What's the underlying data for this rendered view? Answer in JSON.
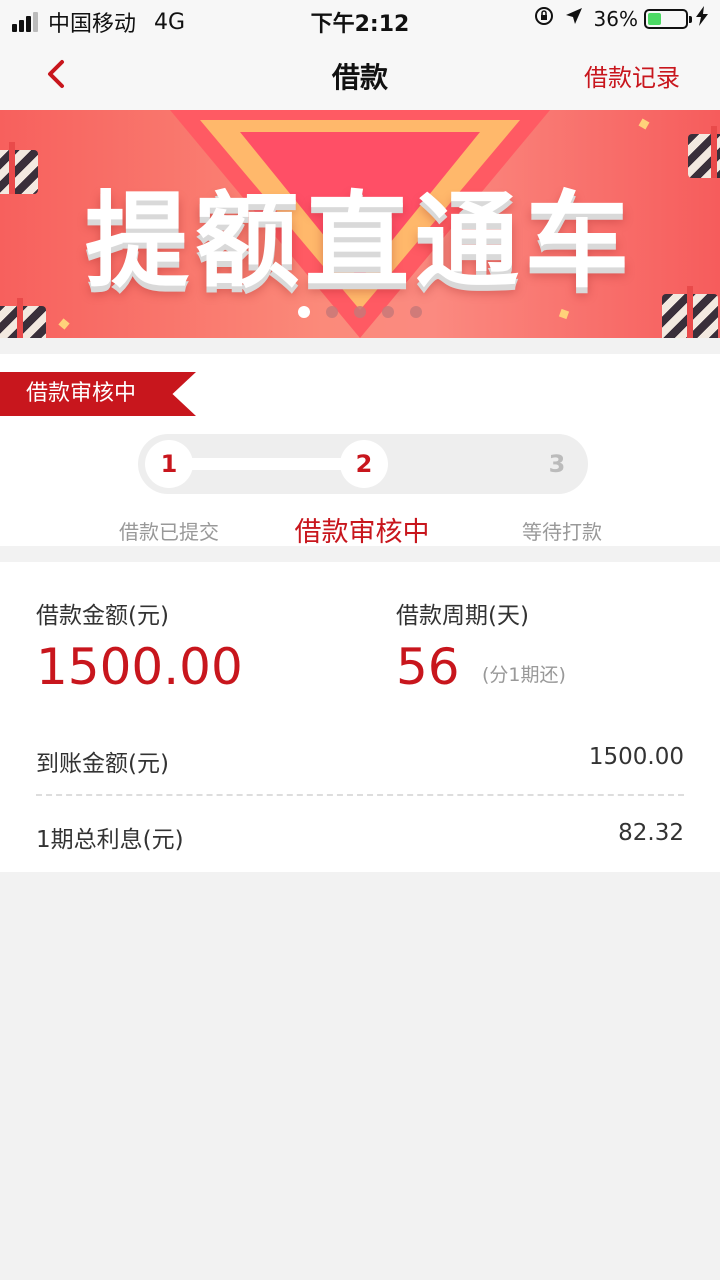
{
  "status_bar": {
    "carrier": "中国移动",
    "network": "4G",
    "time": "下午2:12",
    "battery": "36%",
    "battery_level": 0.36
  },
  "nav": {
    "title": "借款",
    "right_link": "借款记录"
  },
  "banner": {
    "headline": "提额直通车",
    "slide_count": 5,
    "active_slide": 1
  },
  "progress": {
    "ribbon": "借款审核中",
    "steps": [
      {
        "number": "1",
        "label": "借款已提交"
      },
      {
        "number": "2",
        "label": "借款审核中"
      },
      {
        "number": "3",
        "label": "等待打款"
      }
    ],
    "current_step": 2
  },
  "loan": {
    "amount_label": "借款金额(元)",
    "amount": "1500.00",
    "period_label": "借款周期(天)",
    "period": "56",
    "period_note": "(分1期还)",
    "received_label": "到账金额(元)",
    "received": "1500.00",
    "interest_label": "1期总利息(元)",
    "interest": "82.32"
  },
  "colors": {
    "accent": "#c8161d",
    "background": "#f2f2f2"
  }
}
